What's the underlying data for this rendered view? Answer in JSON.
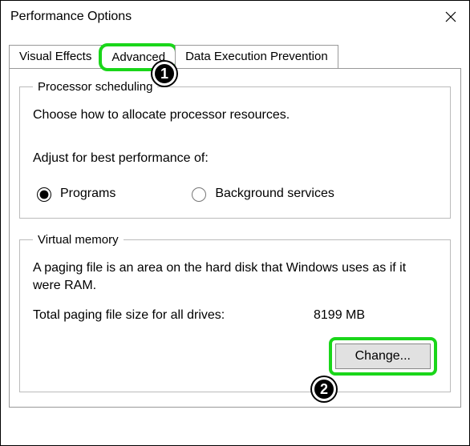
{
  "window": {
    "title": "Performance Options"
  },
  "tabs": {
    "t0": "Visual Effects",
    "t1": "Advanced",
    "t2": "Data Execution Prevention"
  },
  "processor": {
    "legend": "Processor scheduling",
    "desc": "Choose how to allocate processor resources.",
    "sub": "Adjust for best performance of:",
    "opt_programs": "Programs",
    "opt_background": "Background services"
  },
  "vmem": {
    "legend": "Virtual memory",
    "desc": "A paging file is an area on the hard disk that Windows uses as if it were RAM.",
    "total_label": "Total paging file size for all drives:",
    "total_value": "8199 MB",
    "change_btn": "Change..."
  },
  "callouts": {
    "c1": "1",
    "c2": "2"
  }
}
